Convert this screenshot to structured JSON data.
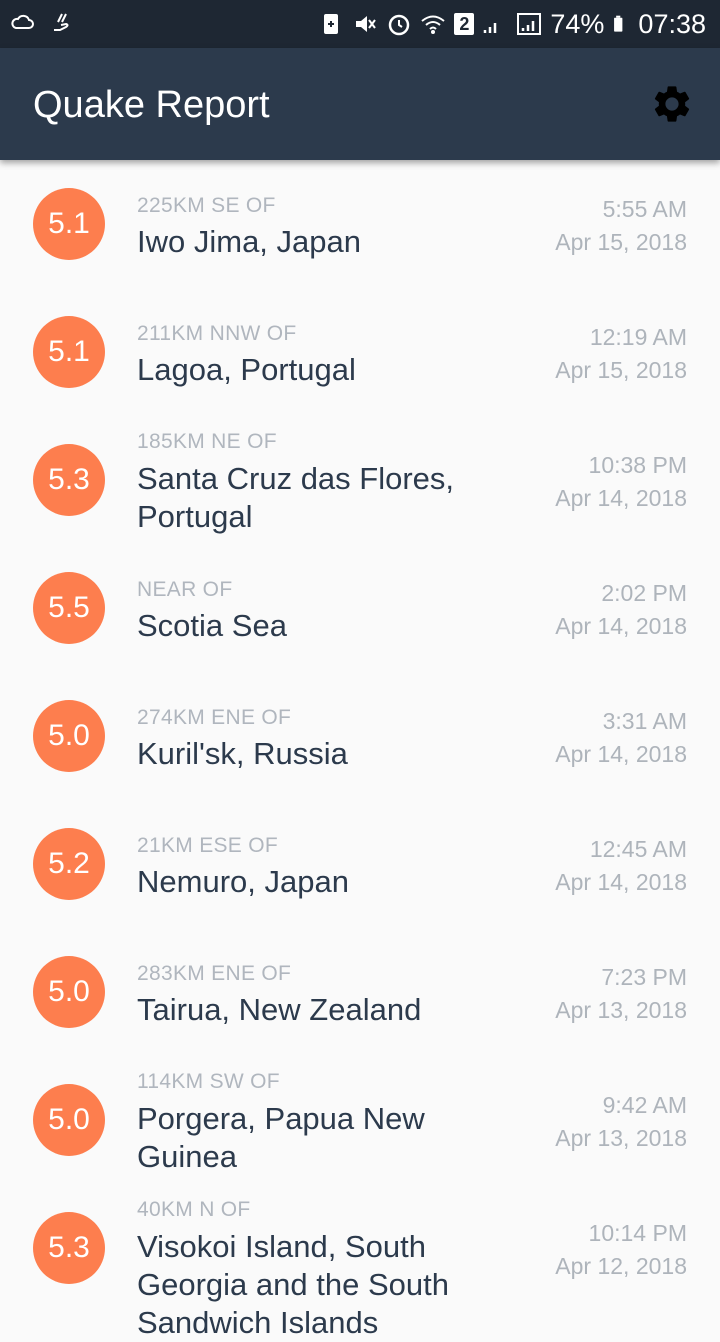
{
  "status_bar": {
    "battery_percent": "74%",
    "time": "07:38",
    "notification_count": "2"
  },
  "app_bar": {
    "title": "Quake Report",
    "settings_icon": "gear-icon"
  },
  "colors": {
    "app_bar": "#2c3a4c",
    "status_bar": "#1e2733",
    "magnitude_circle": "#fd7e4e",
    "background": "#fafafa"
  },
  "earthquakes": [
    {
      "magnitude": "5.1",
      "offset": "225km SE of",
      "place": "Iwo Jima, Japan",
      "time": "5:55 AM",
      "date": "Apr 15, 2018"
    },
    {
      "magnitude": "5.1",
      "offset": "211km NNW of",
      "place": "Lagoa, Portugal",
      "time": "12:19 AM",
      "date": "Apr 15, 2018"
    },
    {
      "magnitude": "5.3",
      "offset": "185km NE of",
      "place": "Santa Cruz das Flores, Portugal",
      "time": "10:38 PM",
      "date": "Apr 14, 2018"
    },
    {
      "magnitude": "5.5",
      "offset": "Near of",
      "place": "Scotia Sea",
      "time": "2:02 PM",
      "date": "Apr 14, 2018"
    },
    {
      "magnitude": "5.0",
      "offset": "274km ENE of",
      "place": "Kuril'sk, Russia",
      "time": "3:31 AM",
      "date": "Apr 14, 2018"
    },
    {
      "magnitude": "5.2",
      "offset": "21km ESE of",
      "place": "Nemuro, Japan",
      "time": "12:45 AM",
      "date": "Apr 14, 2018"
    },
    {
      "magnitude": "5.0",
      "offset": "283km ENE of",
      "place": "Tairua, New Zealand",
      "time": "7:23 PM",
      "date": "Apr 13, 2018"
    },
    {
      "magnitude": "5.0",
      "offset": "114km SW of",
      "place": "Porgera, Papua New Guinea",
      "time": "9:42 AM",
      "date": "Apr 13, 2018"
    },
    {
      "magnitude": "5.3",
      "offset": "40km N of",
      "place": "Visokoi Island, South Georgia and the South Sandwich Islands",
      "time": "10:14 PM",
      "date": "Apr 12, 2018"
    }
  ]
}
